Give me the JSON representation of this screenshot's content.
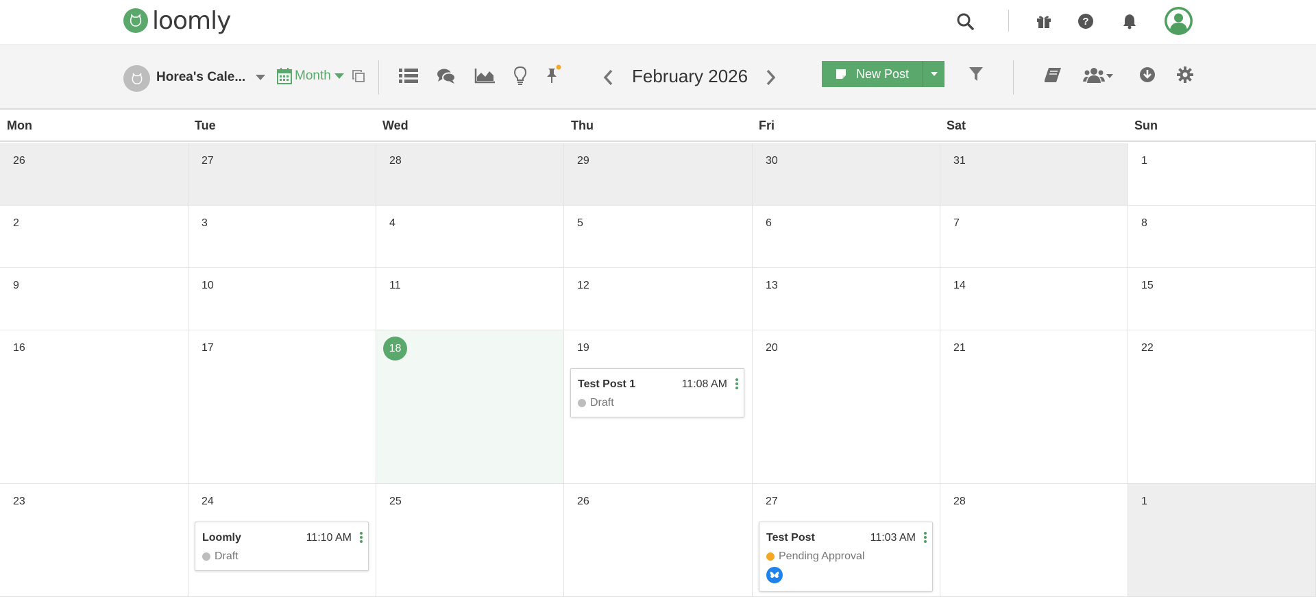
{
  "app": {
    "logo_text": "loomly"
  },
  "topbar": {
    "icons": [
      "search-icon",
      "gift-icon",
      "help-icon",
      "bell-icon",
      "user-avatar"
    ]
  },
  "toolbar": {
    "calendar_name": "Horea's Cale...",
    "view_label": "Month",
    "date_title": "February 2026",
    "new_post_label": "New Post"
  },
  "calendar": {
    "days_of_week": [
      "Mon",
      "Tue",
      "Wed",
      "Thu",
      "Fri",
      "Sat",
      "Sun"
    ],
    "weeks": [
      [
        "26",
        "27",
        "28",
        "29",
        "30",
        "31",
        "1"
      ],
      [
        "2",
        "3",
        "4",
        "5",
        "6",
        "7",
        "8"
      ],
      [
        "9",
        "10",
        "11",
        "12",
        "13",
        "14",
        "15"
      ],
      [
        "16",
        "17",
        "18",
        "19",
        "20",
        "21",
        "22"
      ],
      [
        "23",
        "24",
        "25",
        "26",
        "27",
        "28",
        "1"
      ]
    ],
    "today": "18",
    "posts": [
      {
        "title": "Test Post 1",
        "time": "11:08 AM",
        "status": "Draft",
        "status_color": "#bdbdbd"
      },
      {
        "title": "Loomly",
        "time": "11:10 AM",
        "status": "Draft",
        "status_color": "#bdbdbd"
      },
      {
        "title": "Test Post",
        "time": "11:03 AM",
        "status": "Pending Approval",
        "status_color": "#f5a623",
        "channel_icon": "bluesky-icon"
      }
    ]
  },
  "colors": {
    "brand_green": "#5aa86b",
    "today_bg": "#f2f8f3",
    "other_month_bg": "#eeeeee"
  }
}
